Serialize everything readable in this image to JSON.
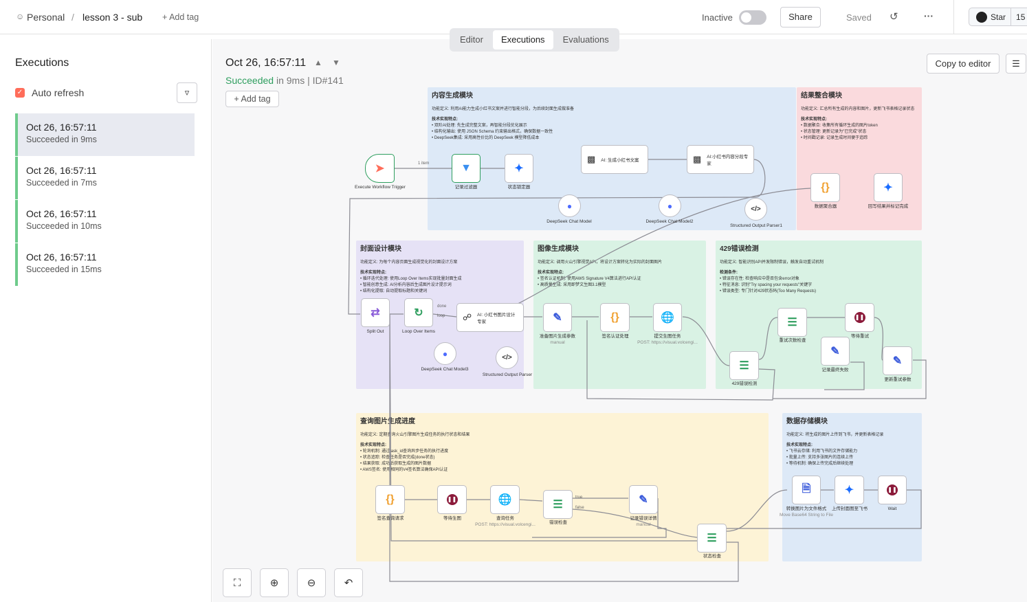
{
  "header": {
    "workspace": "Personal",
    "separator": "/",
    "workflow_name": "lesson 3 - sub",
    "add_tag": "+ Add tag",
    "status": "Inactive",
    "share": "Share",
    "saved": "Saved",
    "more": "···",
    "star": "Star",
    "star_count": "15"
  },
  "tabs": [
    "Editor",
    "Executions",
    "Evaluations"
  ],
  "sidebar": {
    "title": "Executions",
    "auto_refresh": "Auto refresh",
    "items": [
      {
        "time": "Oct 26, 16:57:11",
        "status": "Succeeded in 9ms"
      },
      {
        "time": "Oct 26, 16:57:11",
        "status": "Succeeded in 7ms"
      },
      {
        "time": "Oct 26, 16:57:11",
        "status": "Succeeded in 10ms"
      },
      {
        "time": "Oct 26, 16:57:11",
        "status": "Succeeded in 15ms"
      }
    ]
  },
  "execution": {
    "time": "Oct 26, 16:57:11",
    "succeeded": "Succeeded",
    "in": "in 9ms",
    "sep": "|",
    "id": "ID#141",
    "add_tag": "Add tag",
    "copy_to_editor": "Copy to editor"
  },
  "sticky": {
    "content": {
      "title": "内容生成模块",
      "l1": "功能定义: 利用AI能力生成小红书文案并进行智能分段，为后续封面生成做准备",
      "l2": "技术实现特点:",
      "b1": "• 双阶AI处理: 先生成完整文案，再智能分段优化展示",
      "b2": "• 结构化输出: 使用 JSON Schema 约束输出格式，确保数据一致性",
      "b3": "• DeepSeek集成: 采用高性价比的 DeepSeek 模型降低成本"
    },
    "result": {
      "title": "结果整合模块",
      "l1": "功能定义: 汇总所有生成的内容和图片，更新飞书表格记录状态",
      "l2": "技术实现特点:",
      "b1": "• 数据聚合: 收集所有循环生成的图片token",
      "b2": "• 状态管理: 更新记录为\"已完成\"状态",
      "b3": "• 时间戳记录: 记录生成时间便于追踪"
    },
    "cover": {
      "title": "封面设计模块",
      "l1": "功能定义: 为每个内容页面生成视觉化的封面设计方案",
      "l2": "技术实现特点:",
      "b1": "• 循环迭代处理: 使用Loop Over Items实现批量封面生成",
      "b2": "• 智能创意生成: AI分析内容后生成图片设计提示词",
      "b3": "• 结构化提取: 自动提取标题和关键词"
    },
    "image": {
      "title": "图像生成模块",
      "l1": "功能定义: 调用火山引擎视觉API，将设计方案转化为实际的封面图片",
      "l2": "技术实现特点:",
      "b1": "• 签名认证机制: 使用AWS Signature V4算法进行API认证",
      "b2": "• 高质量生成: 采用即梦文生图3.1模型"
    },
    "err429": {
      "title": "429错误检测",
      "l1": "功能定义: 智能识别API并发限制错误，触发自动重试机制",
      "l2": "检测条件:",
      "b1": "• 错误存在性: 检查响应中是否包含error对象",
      "b2": "• 特征消息: 识别\"Try spacing your requests\"关键字",
      "b3": "• 错误类型: 专门针对429状态码(Too Many Requests)"
    },
    "query": {
      "title": "查询图片生成进度",
      "l1": "功能定义: 定期查询火山引擎图片生成任务的执行状态和结果",
      "l2": "技术实现特点:",
      "b1": "• 轮询机制: 通过task_id查询异步任务的执行进度",
      "b2": "• 状态追踪: 检查任务是否完成(done状态)",
      "b3": "• 结果获取: 成功后获取生成的图片数据",
      "b4": "• AWS签名: 使用相同的V4签名算法确保API认证"
    },
    "storage": {
      "title": "数据存储模块",
      "l1": "功能定义: 将生成的图片上传到飞书，并更新表格记录",
      "l2": "技术实现特点:",
      "b1": "• 飞书云存储: 利用飞书的文件存储能力",
      "b2": "• 批量上传: 支持多张图片的连续上传",
      "b3": "• 等待机制: 确保上传完成后继续处理"
    }
  },
  "nodes": {
    "trigger": "Execute Workflow Trigger",
    "filter": "记录过滤器",
    "lark1": "状态锁定器",
    "ai_writer": "AI: 生成小红书文案",
    "ai_splitter": "AI:小红书内容分段专家",
    "merge": "数据聚合器",
    "lark_done": "回写结果并标记完成",
    "ds1": "DeepSeek Chat Model",
    "ds2": "DeepSeek Chat Model2",
    "parser1": "Structured Output Parser1",
    "split": "Split Out",
    "loop": "Loop Over Items",
    "ai_cover": "AI: 小红书图片设计专家",
    "ds3": "DeepSeek Chat Model3",
    "parser": "Structured Output Parser",
    "prep": "准备图片生成参数",
    "manual": "manual",
    "sign": "签名认证处理",
    "submit": "提交生图任务",
    "post_url": "POST: https://visual.volcengi...",
    "check429": "429错误检测",
    "retry_check": "重试次数检查",
    "wait_retry": "等待重试",
    "log_fail": "记录最终失败",
    "update_retry": "更新重试参数",
    "sign_query": "签名查询请求",
    "wait_img": "等待生图",
    "query_task": "查询任务",
    "err_check": "错误检查",
    "log_err": "记录错误详情",
    "status_check": "状态检查",
    "convert": "转换图片为文件格式",
    "convert_sub": "Move Base64 String to File",
    "upload": "上传封面图至飞书",
    "wait": "Wait",
    "edge_1item": "1 item",
    "edge_model": "Model",
    "edge_memory": "Memory",
    "edge_tool": "Tool",
    "edge_parser": "Output Parser",
    "edge_done": "done",
    "edge_loop": "loop",
    "edge_true": "true",
    "edge_false": "false"
  },
  "colors": {
    "content": "#dde9f7",
    "result": "#fadadd",
    "cover": "#e6e2f6",
    "image": "#d9f2e4",
    "err429": "#d9f2e4",
    "query": "#fdf3d6",
    "storage": "#dde9f7",
    "success": "#2e9e5e",
    "accent": "#ff6d5a"
  }
}
